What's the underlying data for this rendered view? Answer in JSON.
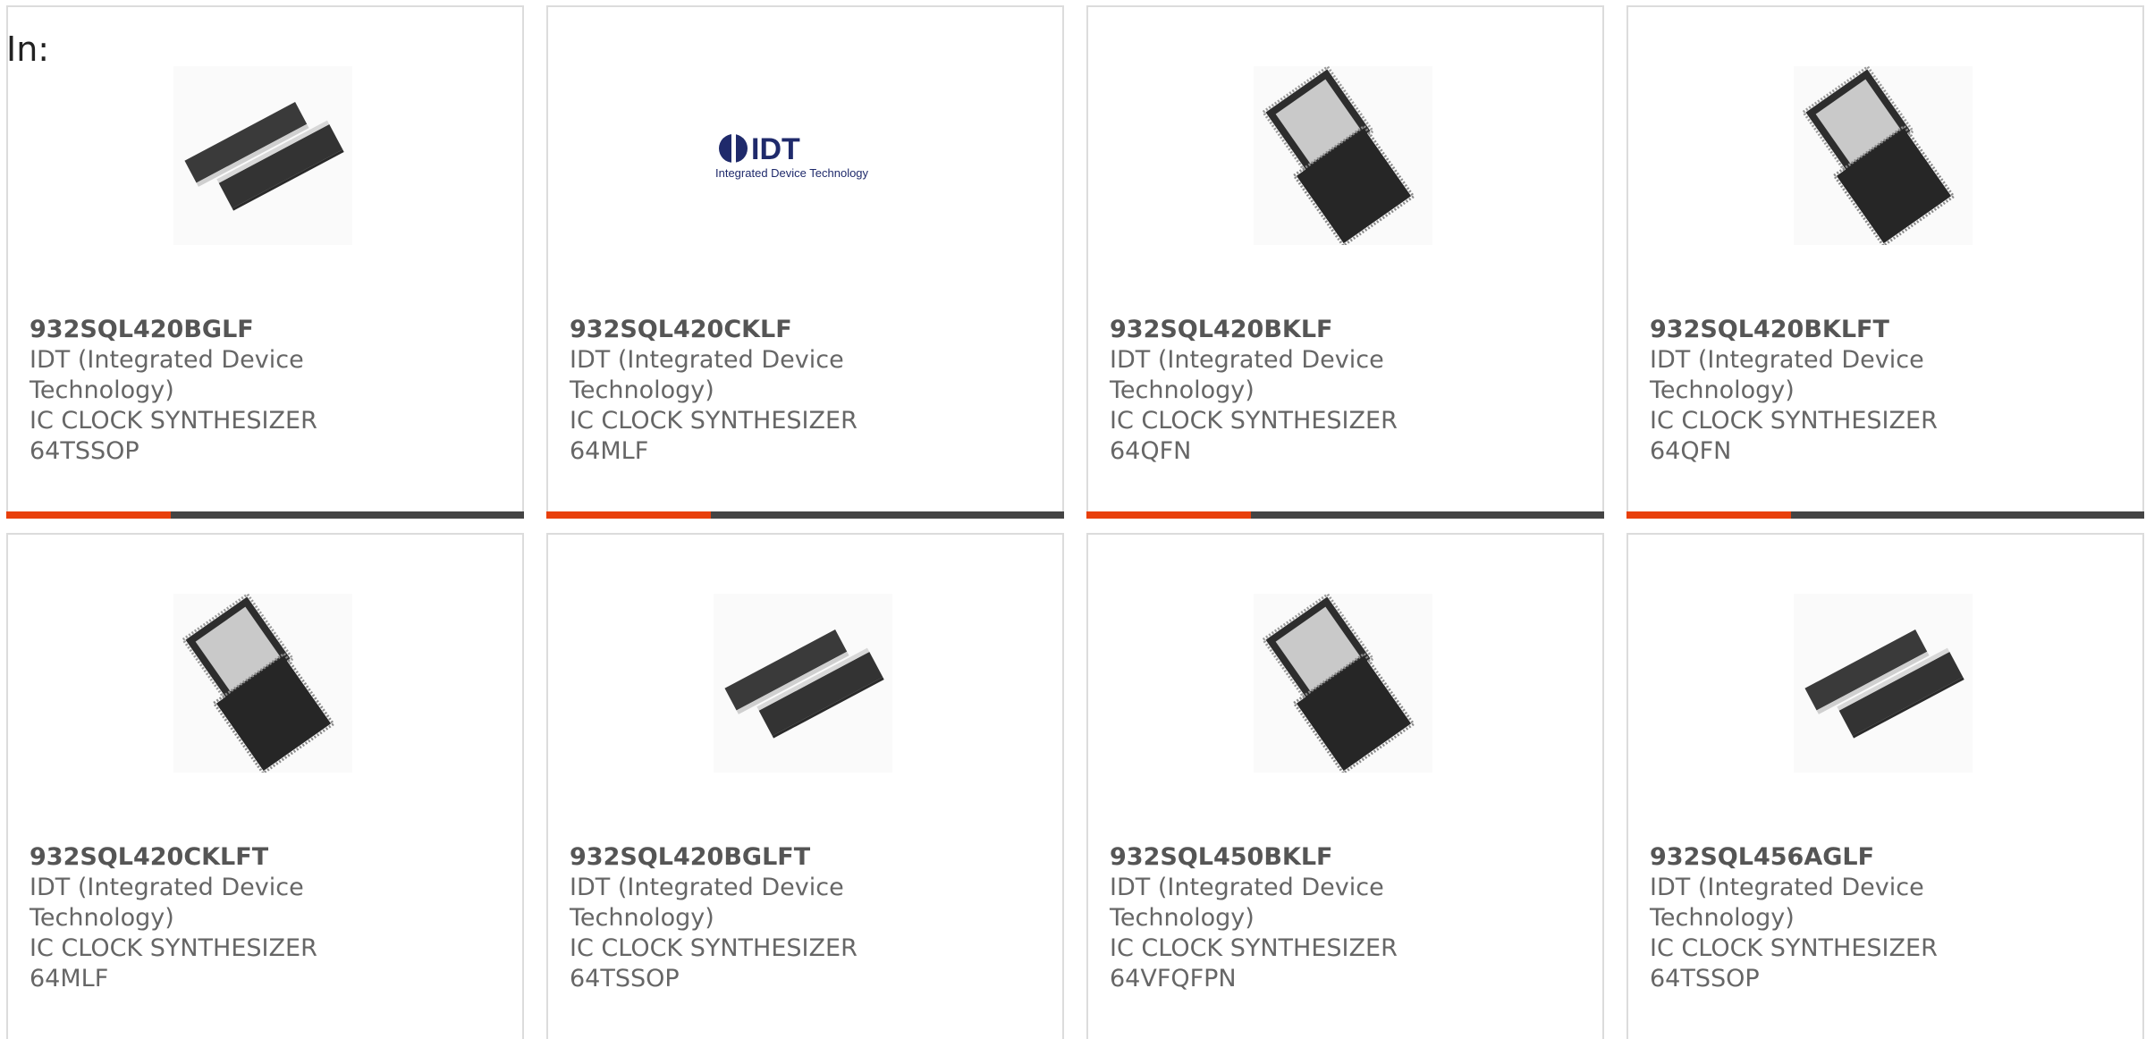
{
  "header": {
    "label": "In:"
  },
  "colors": {
    "accent": "#e8400c",
    "bar": "#444444",
    "border": "#dcdcdc",
    "text": "#666666"
  },
  "products": [
    {
      "part": "932SQL420BGLF",
      "manufacturer": "IDT (Integrated Device Technology)",
      "description": "IC CLOCK SYNTHESIZER 64TSSOP",
      "image": "tssop-package-icon"
    },
    {
      "part": "932SQL420CKLF",
      "manufacturer": "IDT (Integrated Device Technology)",
      "description": "IC CLOCK SYNTHESIZER 64MLF",
      "image": "idt-logo",
      "logo_text": "IDT",
      "logo_subtext": "Integrated Device Technology"
    },
    {
      "part": "932SQL420BKLF",
      "manufacturer": "IDT (Integrated Device Technology)",
      "description": "IC CLOCK SYNTHESIZER 64QFN",
      "image": "qfn-package-icon"
    },
    {
      "part": "932SQL420BKLFT",
      "manufacturer": "IDT (Integrated Device Technology)",
      "description": "IC CLOCK SYNTHESIZER 64QFN",
      "image": "qfn-package-icon"
    },
    {
      "part": "932SQL420CKLFT",
      "manufacturer": "IDT (Integrated Device Technology)",
      "description": "IC CLOCK SYNTHESIZER 64MLF",
      "image": "qfn-package-icon"
    },
    {
      "part": "932SQL420BGLFT",
      "manufacturer": "IDT (Integrated Device Technology)",
      "description": "IC CLOCK SYNTHESIZER 64TSSOP",
      "image": "tssop-package-icon"
    },
    {
      "part": "932SQL450BKLF",
      "manufacturer": "IDT (Integrated Device Technology)",
      "description": "IC CLOCK SYNTHESIZER 64VFQFPN",
      "image": "qfn-package-icon"
    },
    {
      "part": "932SQL456AGLF",
      "manufacturer": "IDT (Integrated Device Technology)",
      "description": "IC CLOCK SYNTHESIZER 64TSSOP",
      "image": "tssop-package-icon"
    }
  ]
}
